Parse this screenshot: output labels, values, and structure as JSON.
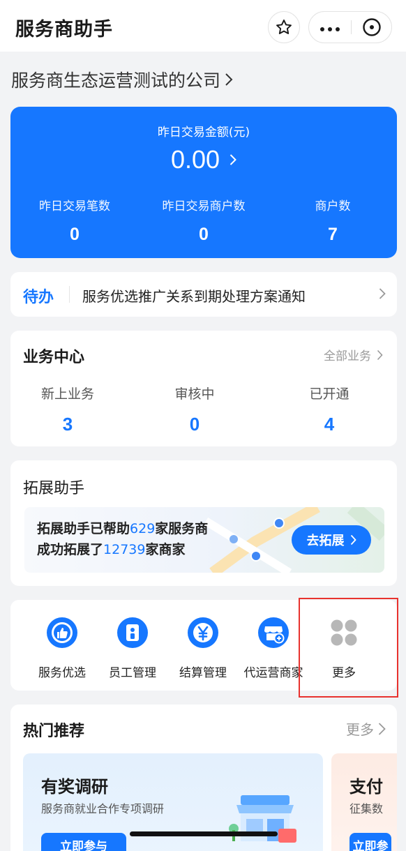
{
  "nav": {
    "title": "服务商助手"
  },
  "company": {
    "name": "服务商生态运营测试的公司"
  },
  "stats": {
    "amount_label": "昨日交易金额(元)",
    "amount_value": "0.00",
    "items": [
      {
        "label": "昨日交易笔数",
        "value": "0"
      },
      {
        "label": "昨日交易商户数",
        "value": "0"
      },
      {
        "label": "商户数",
        "value": "7"
      }
    ]
  },
  "todo": {
    "tag": "待办",
    "text": "服务优选推广关系到期处理方案通知"
  },
  "business": {
    "title": "业务中心",
    "all_label": "全部业务",
    "items": [
      {
        "label": "新上业务",
        "value": "3"
      },
      {
        "label": "审核中",
        "value": "0"
      },
      {
        "label": "已开通",
        "value": "4"
      }
    ]
  },
  "expand": {
    "title": "拓展助手",
    "line1_prefix": "拓展助手已帮助",
    "line1_count": "629",
    "line1_suffix": "家服务商",
    "line2_prefix": "成功拓展了",
    "line2_count": "12739",
    "line2_suffix": "家商家",
    "button": "去拓展"
  },
  "tools": [
    {
      "label": "服务优选",
      "icon": "thumbs-up-icon"
    },
    {
      "label": "员工管理",
      "icon": "staff-icon"
    },
    {
      "label": "结算管理",
      "icon": "yen-icon"
    },
    {
      "label": "代运营商家",
      "icon": "store-plus-icon"
    },
    {
      "label": "更多",
      "icon": "grid-dots-icon"
    }
  ],
  "hot": {
    "title": "热门推荐",
    "more_label": "更多",
    "cards": [
      {
        "title": "有奖调研",
        "subtitle": "服务商就业合作专项调研",
        "button": "立即参与"
      },
      {
        "title": "支付",
        "subtitle": "征集数",
        "button": "立即参与"
      }
    ]
  },
  "colors": {
    "primary": "#1677ff",
    "highlight_box": "#e8322e",
    "background": "#f2f3f5"
  }
}
